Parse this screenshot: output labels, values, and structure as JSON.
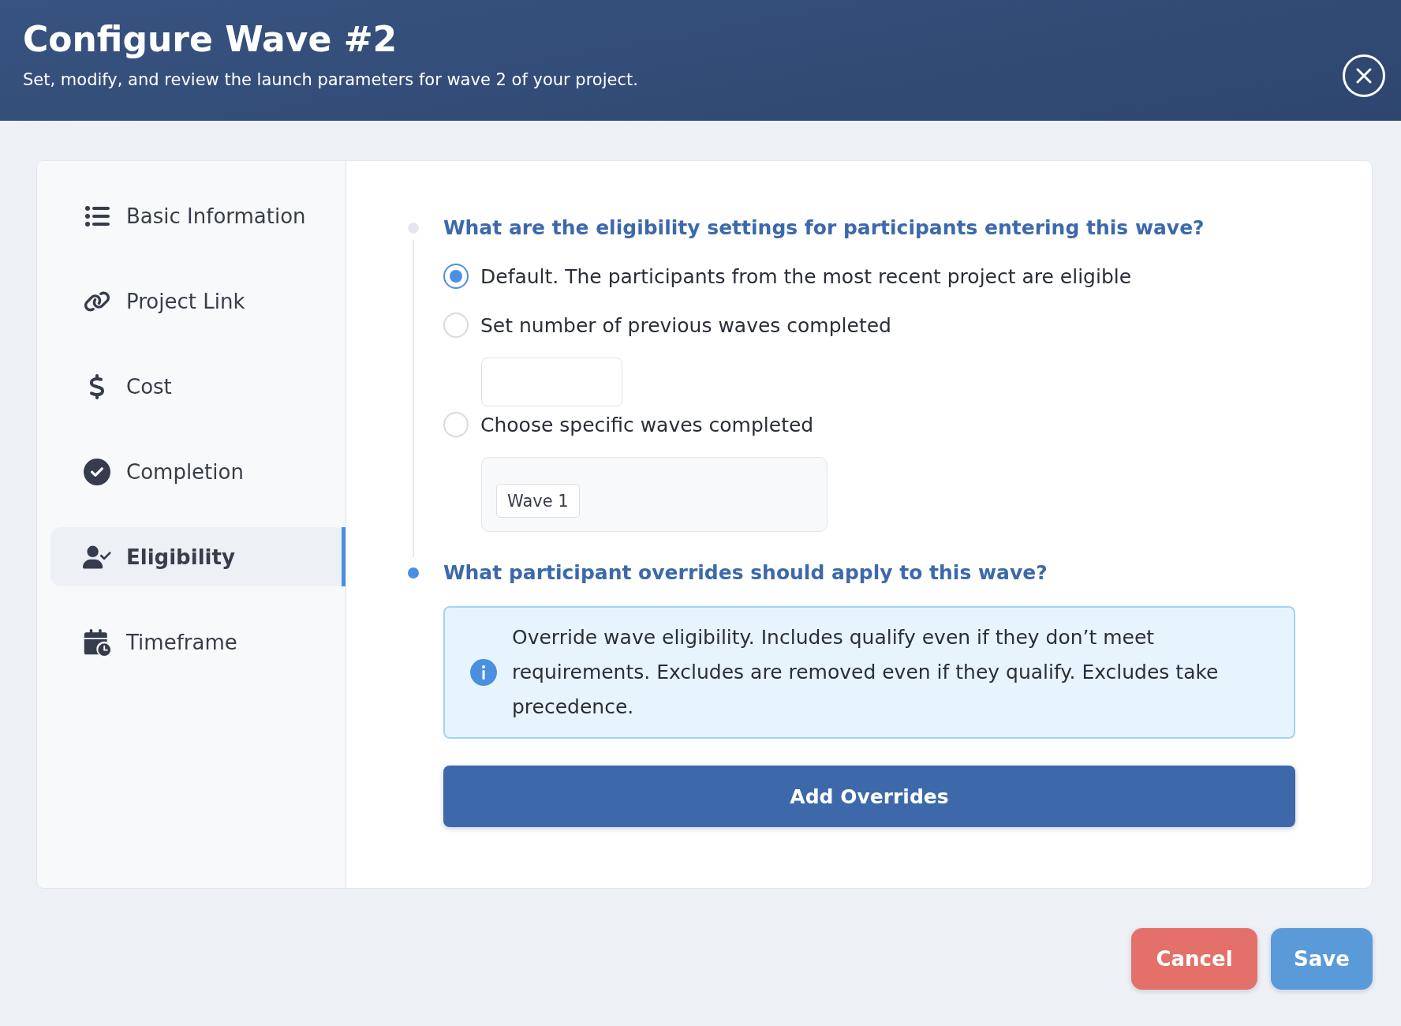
{
  "header": {
    "title": "Configure Wave #2",
    "subtitle": "Set, modify, and review the launch parameters for wave 2 of your project."
  },
  "sidebar": {
    "items": [
      {
        "label": "Basic Information",
        "selected": false
      },
      {
        "label": "Project Link",
        "selected": false
      },
      {
        "label": "Cost",
        "selected": false
      },
      {
        "label": "Completion",
        "selected": false
      },
      {
        "label": "Eligibility",
        "selected": true
      },
      {
        "label": "Timeframe",
        "selected": false
      }
    ]
  },
  "sections": [
    {
      "question": "What are the eligibility settings for participants entering this wave?",
      "active": false,
      "options": [
        {
          "kind": "plain",
          "label": "Default. The participants from the most recent project are eligible",
          "selected": true
        },
        {
          "kind": "number",
          "label": "Set number of previous waves completed",
          "selected": false
        },
        {
          "kind": "waves",
          "label": "Choose specific waves completed",
          "selected": false,
          "tags": [
            "Wave 1"
          ]
        }
      ]
    },
    {
      "question": "What participant overrides should apply to this wave?",
      "active": true,
      "notice": "Override wave eligibility. Includes qualify even if they don’t meet requirements. Excludes are removed even if they qualify. Excludes take precedence.",
      "button": "Add Overrides"
    }
  ],
  "footer": {
    "buttons": [
      {
        "kind": "cancel",
        "label": "Cancel"
      },
      {
        "kind": "save",
        "label": "Save"
      }
    ]
  }
}
